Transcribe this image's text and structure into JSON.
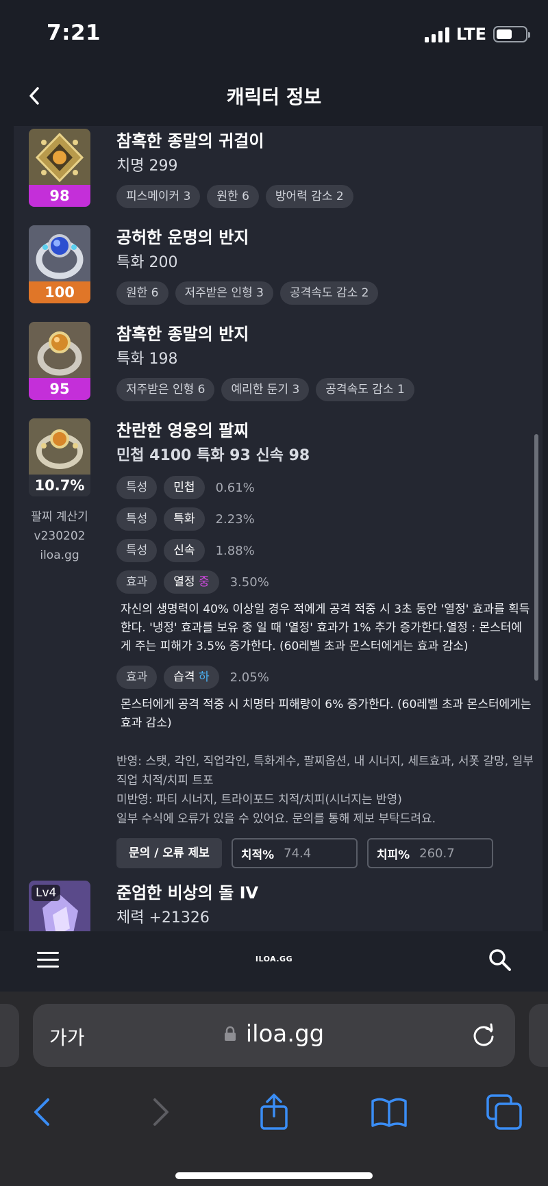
{
  "status_bar": {
    "time": "7:21",
    "network": "LTE"
  },
  "header": {
    "title": "캐릭터 정보"
  },
  "items": [
    {
      "name": "참혹한 종말의 귀걸이",
      "stat": "치명 299",
      "quality": "98",
      "engravings": [
        "피스메이커 3",
        "원한 6",
        "방어력 감소 2"
      ]
    },
    {
      "name": "공허한 운명의 반지",
      "stat": "특화 200",
      "quality": "100",
      "engravings": [
        "원한 6",
        "저주받은 인형 3",
        "공격속도 감소 2"
      ]
    },
    {
      "name": "참혹한 종말의 반지",
      "stat": "특화 198",
      "quality": "95",
      "engravings": [
        "저주받은 인형 6",
        "예리한 둔기 3",
        "공격속도 감소 1"
      ]
    }
  ],
  "bracelet": {
    "name": "찬란한 영웅의 팔찌",
    "stats": "민첩 4100  특화 93  신속 98",
    "percent": "10.7%",
    "calc_lines": [
      "팔찌 계산기",
      "v230202",
      "iloa.gg"
    ],
    "rows": [
      {
        "type": "특성",
        "name": "민첩",
        "value": "0.61%"
      },
      {
        "type": "특성",
        "name": "특화",
        "value": "2.23%"
      },
      {
        "type": "특성",
        "name": "신속",
        "value": "1.88%"
      }
    ],
    "effect1": {
      "type": "효과",
      "name": "열정",
      "grade": "중",
      "value": "3.50%",
      "desc": "자신의 생명력이 40% 이상일 경우 적에게 공격 적중 시 3초 동안 '열정' 효과를 획득한다. '냉정' 효과를 보유 중 일 때 '열정' 효과가 1% 추가 증가한다.열정 : 몬스터에게 주는 피해가 3.5% 증가한다. (60레벨 초과 몬스터에게는 효과 감소)"
    },
    "effect2": {
      "type": "효과",
      "name": "습격",
      "grade": "하",
      "value": "2.05%",
      "desc": "몬스터에게 공격 적중 시 치명타 피해량이 6% 증가한다. (60레벨 초과 몬스터에게는 효과 감소)"
    },
    "notes": [
      "반영: 스탯, 각인, 직업각인, 특화계수, 팔찌옵션, 내 시너지, 세트효과, 서폿 갈망, 일부 직업 치적/치피 트포",
      "미반영: 파티 시너지, 트라이포드 치적/치피(시너지는 반영)",
      "일부 수식에 오류가 있을 수 있어요. 문의를 통해 제보 부탁드려요."
    ],
    "report_button": "문의 / 오류 제보",
    "crit_rate_label": "치적%",
    "crit_rate_value": "74.4",
    "crit_dmg_label": "치피%",
    "crit_dmg_value": "260.7"
  },
  "stone": {
    "level": "Lv4",
    "name": "준엄한 비상의 돌 IV",
    "stat": "체력 +21326"
  },
  "site_nav": {
    "logo": "ILOA.GG"
  },
  "browser": {
    "text_size": "가가",
    "url": "iloa.gg"
  },
  "colors": {
    "relic": "#c42fd9",
    "ancient": "#e07628",
    "grade_mid": "#d84ae8",
    "grade_low": "#4ab0f2"
  },
  "icons": [
    "back-icon",
    "menu-icon",
    "search-icon",
    "lock-icon",
    "reload-icon",
    "back-arrow-icon",
    "forward-arrow-icon",
    "share-icon",
    "bookmarks-icon",
    "tabs-icon"
  ]
}
